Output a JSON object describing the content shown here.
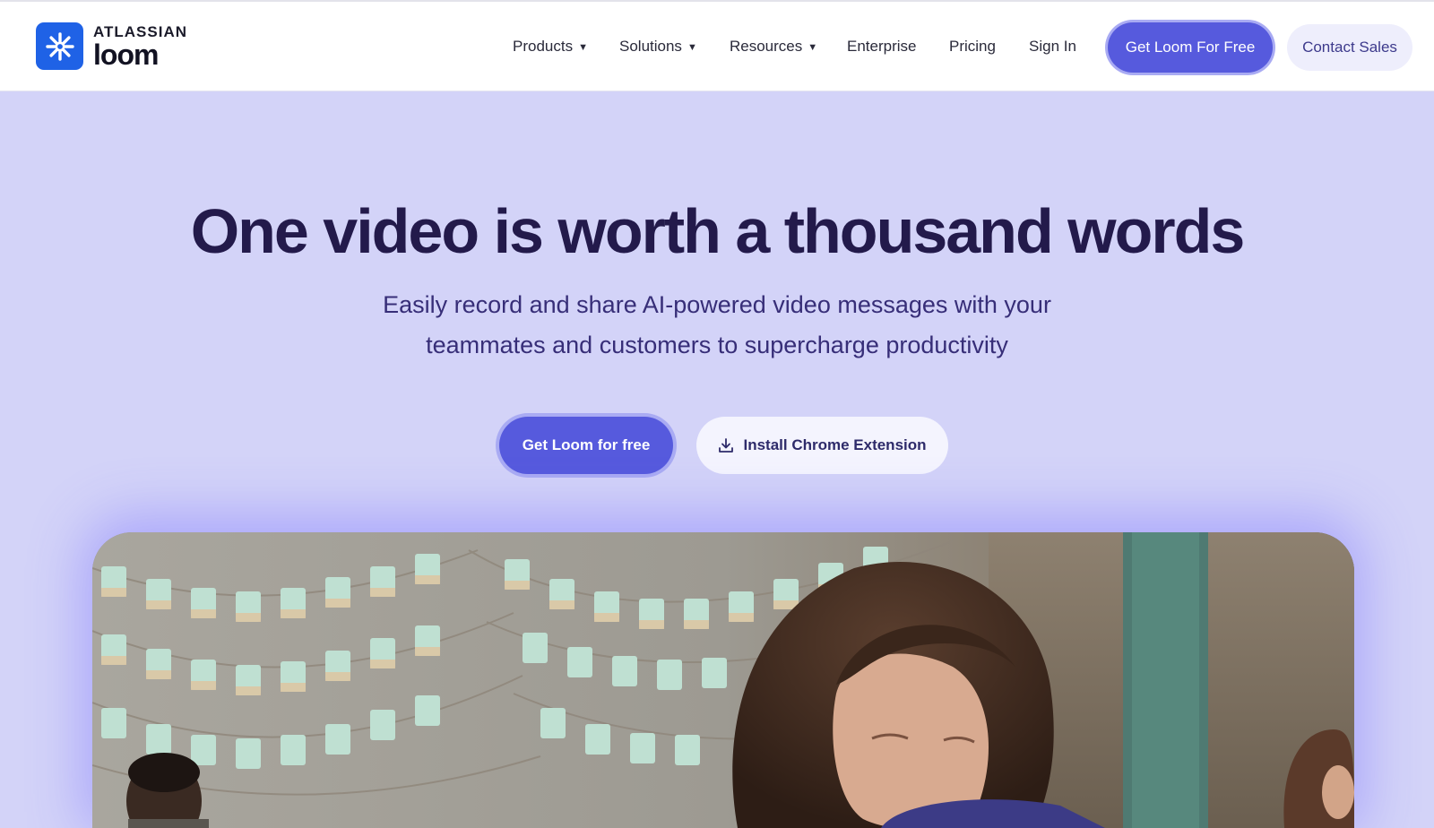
{
  "brand": {
    "company": "ATLASSIAN",
    "product": "loom"
  },
  "nav": {
    "items": [
      {
        "label": "Products",
        "dropdown": true
      },
      {
        "label": "Solutions",
        "dropdown": true
      },
      {
        "label": "Resources",
        "dropdown": true
      },
      {
        "label": "Enterprise",
        "dropdown": false
      },
      {
        "label": "Pricing",
        "dropdown": false
      },
      {
        "label": "Sign In",
        "dropdown": false
      }
    ],
    "primary_cta": "Get Loom For Free",
    "secondary_cta": "Contact Sales"
  },
  "hero": {
    "title": "One video is worth a thousand words",
    "subtitle_line1": "Easily record and share AI-powered video messages with your",
    "subtitle_line2": "teammates and customers to supercharge productivity",
    "primary_cta": "Get Loom for free",
    "secondary_cta": "Install Chrome Extension",
    "secondary_cta_icon": "download-icon"
  },
  "colors": {
    "accent": "#565add",
    "background": "#d3d3f8",
    "heading": "#231a4b",
    "brand_blue": "#1f62e6"
  }
}
